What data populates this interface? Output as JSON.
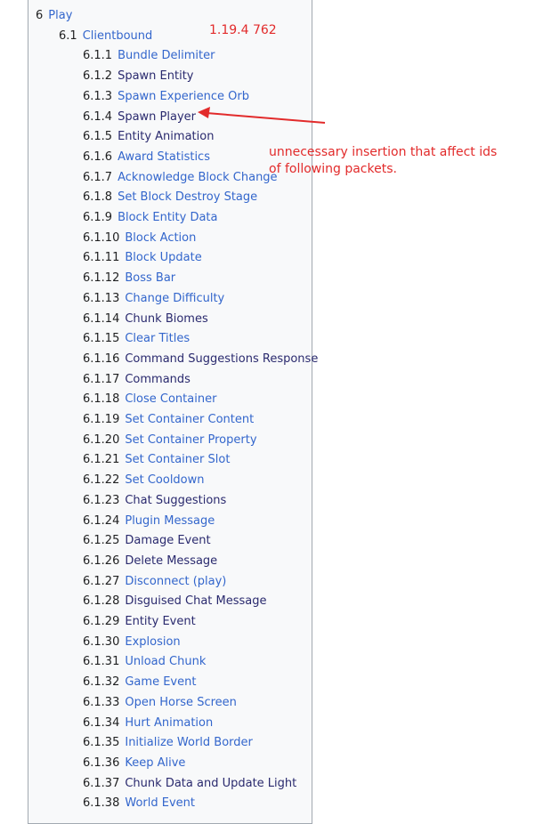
{
  "toc": {
    "sections": [
      {
        "num": "6",
        "label": "Play",
        "level": 1,
        "visited": false
      },
      {
        "num": "6.1",
        "label": "Clientbound",
        "level": 2,
        "visited": false
      },
      {
        "num": "6.1.1",
        "label": "Bundle Delimiter",
        "level": 3,
        "visited": false
      },
      {
        "num": "6.1.2",
        "label": "Spawn Entity",
        "level": 3,
        "visited": true
      },
      {
        "num": "6.1.3",
        "label": "Spawn Experience Orb",
        "level": 3,
        "visited": false
      },
      {
        "num": "6.1.4",
        "label": "Spawn Player",
        "level": 3,
        "visited": true
      },
      {
        "num": "6.1.5",
        "label": "Entity Animation",
        "level": 3,
        "visited": true
      },
      {
        "num": "6.1.6",
        "label": "Award Statistics",
        "level": 3,
        "visited": false
      },
      {
        "num": "6.1.7",
        "label": "Acknowledge Block Change",
        "level": 3,
        "visited": false
      },
      {
        "num": "6.1.8",
        "label": "Set Block Destroy Stage",
        "level": 3,
        "visited": false
      },
      {
        "num": "6.1.9",
        "label": "Block Entity Data",
        "level": 3,
        "visited": false
      },
      {
        "num": "6.1.10",
        "label": "Block Action",
        "level": 3,
        "visited": false
      },
      {
        "num": "6.1.11",
        "label": "Block Update",
        "level": 3,
        "visited": false
      },
      {
        "num": "6.1.12",
        "label": "Boss Bar",
        "level": 3,
        "visited": false
      },
      {
        "num": "6.1.13",
        "label": "Change Difficulty",
        "level": 3,
        "visited": false
      },
      {
        "num": "6.1.14",
        "label": "Chunk Biomes",
        "level": 3,
        "visited": true
      },
      {
        "num": "6.1.15",
        "label": "Clear Titles",
        "level": 3,
        "visited": false
      },
      {
        "num": "6.1.16",
        "label": "Command Suggestions Response",
        "level": 3,
        "visited": true
      },
      {
        "num": "6.1.17",
        "label": "Commands",
        "level": 3,
        "visited": true
      },
      {
        "num": "6.1.18",
        "label": "Close Container",
        "level": 3,
        "visited": false
      },
      {
        "num": "6.1.19",
        "label": "Set Container Content",
        "level": 3,
        "visited": false
      },
      {
        "num": "6.1.20",
        "label": "Set Container Property",
        "level": 3,
        "visited": false
      },
      {
        "num": "6.1.21",
        "label": "Set Container Slot",
        "level": 3,
        "visited": false
      },
      {
        "num": "6.1.22",
        "label": "Set Cooldown",
        "level": 3,
        "visited": false
      },
      {
        "num": "6.1.23",
        "label": "Chat Suggestions",
        "level": 3,
        "visited": true
      },
      {
        "num": "6.1.24",
        "label": "Plugin Message",
        "level": 3,
        "visited": false
      },
      {
        "num": "6.1.25",
        "label": "Damage Event",
        "level": 3,
        "visited": true
      },
      {
        "num": "6.1.26",
        "label": "Delete Message",
        "level": 3,
        "visited": true
      },
      {
        "num": "6.1.27",
        "label": "Disconnect (play)",
        "level": 3,
        "visited": false
      },
      {
        "num": "6.1.28",
        "label": "Disguised Chat Message",
        "level": 3,
        "visited": true
      },
      {
        "num": "6.1.29",
        "label": "Entity Event",
        "level": 3,
        "visited": true
      },
      {
        "num": "6.1.30",
        "label": "Explosion",
        "level": 3,
        "visited": false
      },
      {
        "num": "6.1.31",
        "label": "Unload Chunk",
        "level": 3,
        "visited": false
      },
      {
        "num": "6.1.32",
        "label": "Game Event",
        "level": 3,
        "visited": false
      },
      {
        "num": "6.1.33",
        "label": "Open Horse Screen",
        "level": 3,
        "visited": false
      },
      {
        "num": "6.1.34",
        "label": "Hurt Animation",
        "level": 3,
        "visited": false
      },
      {
        "num": "6.1.35",
        "label": "Initialize World Border",
        "level": 3,
        "visited": false
      },
      {
        "num": "6.1.36",
        "label": "Keep Alive",
        "level": 3,
        "visited": false
      },
      {
        "num": "6.1.37",
        "label": "Chunk Data and Update Light",
        "level": 3,
        "visited": true
      },
      {
        "num": "6.1.38",
        "label": "World Event",
        "level": 3,
        "visited": false
      }
    ]
  },
  "annotations": {
    "version": "1.19.4 762",
    "note": "unnecessary insertion that affect ids of following packets."
  },
  "colors": {
    "link": "#3366cc",
    "visited_link": "#2a2a6e",
    "number": "#202122",
    "annotation": "#e22b2b",
    "toc_background": "#f8f9fa",
    "toc_border": "#a2a9b1"
  }
}
